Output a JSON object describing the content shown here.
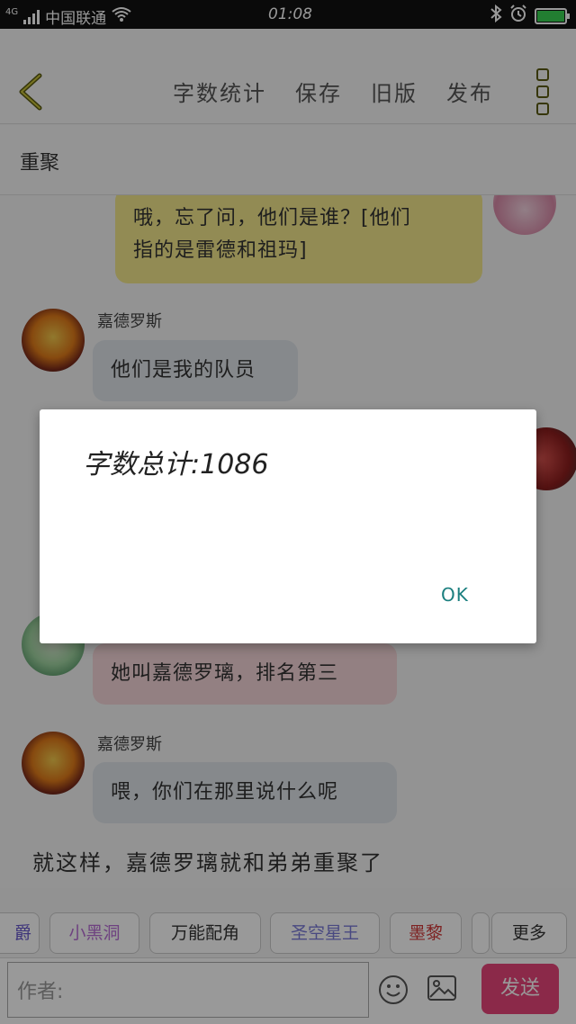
{
  "status_bar": {
    "network_type": "4G",
    "carrier": "中国联通",
    "time": "01:08"
  },
  "toolbar": {
    "buttons": [
      "字数统计",
      "保存",
      "旧版",
      "发布"
    ]
  },
  "chapter": {
    "title": "重聚"
  },
  "chat": {
    "messages": [
      {
        "speaker": "",
        "text_line1": "哦，忘了问，他们是谁？[他们",
        "text_line2": "指的是雷德和祖玛]",
        "color": "#f3e88d"
      },
      {
        "speaker": "嘉德罗斯",
        "text": "他们是我的队员",
        "color": "#dfe4ea"
      },
      {
        "speaker": "",
        "text": "她叫嘉德罗璃，排名第三",
        "color": "#f6d6d9"
      },
      {
        "speaker": "嘉德罗斯",
        "text": "喂，你们在那里说什么呢",
        "color": "#dfe4ea"
      }
    ],
    "narration": "就这样，嘉德罗璃就和弟弟重聚了"
  },
  "characters": {
    "chips": [
      {
        "label": "爵",
        "color": "#6a5acd"
      },
      {
        "label": "小黑洞",
        "color": "#b86fd6"
      },
      {
        "label": "万能配角",
        "color": "#333333"
      },
      {
        "label": "圣空星王",
        "color": "#7a7ad8"
      },
      {
        "label": "墨黎",
        "color": "#d33a3a"
      },
      {
        "label": "更多",
        "color": "#333333"
      }
    ]
  },
  "input": {
    "author_placeholder": "作者:",
    "send_label": "发送"
  },
  "dialog": {
    "message": "字数总计:1086",
    "ok_label": "OK"
  }
}
